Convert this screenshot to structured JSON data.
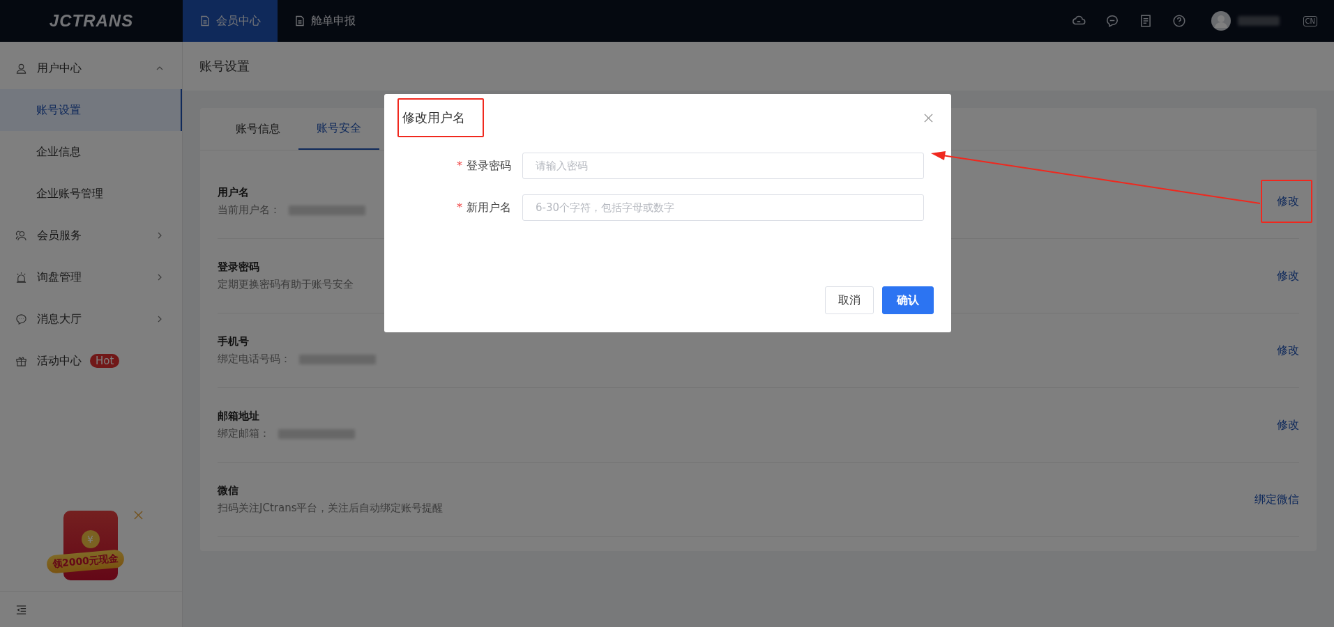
{
  "header": {
    "logo": "JCTRANS",
    "nav": [
      {
        "label": "会员中心",
        "selected": true
      },
      {
        "label": "舱单申报",
        "selected": false
      }
    ],
    "language": "CN"
  },
  "required_mark": "*",
  "sidebar": {
    "items": [
      {
        "label": "用户中心",
        "kind": "user",
        "expanded": true,
        "children": [
          {
            "label": "账号设置",
            "selected": true
          },
          {
            "label": "企业信息",
            "selected": false
          },
          {
            "label": "企业账号管理",
            "selected": false
          }
        ]
      },
      {
        "label": "会员服务",
        "kind": "members",
        "expanded": false
      },
      {
        "label": "询盘管理",
        "kind": "alarm",
        "expanded": false
      },
      {
        "label": "消息大厅",
        "kind": "chat",
        "expanded": false
      },
      {
        "label": "活动中心",
        "kind": "gift",
        "badge": "Hot"
      }
    ],
    "promo": {
      "coin": "¥",
      "label": "领2000元现金"
    }
  },
  "page_title": "账号设置",
  "tabs": [
    {
      "label": "账号信息",
      "selected": false
    },
    {
      "label": "账号安全",
      "selected": true
    }
  ],
  "rows": [
    {
      "title": "用户名",
      "description": "当前用户名：",
      "masked_value": true,
      "action": "修改"
    },
    {
      "title": "登录密码",
      "description": "定期更换密码有助于账号安全",
      "masked_value": false,
      "action": "修改"
    },
    {
      "title": "手机号",
      "description": "绑定电话号码：",
      "masked_value": true,
      "action": "修改"
    },
    {
      "title": "邮箱地址",
      "description": "绑定邮箱：",
      "masked_value": true,
      "action": "修改"
    },
    {
      "title": "微信",
      "description": "扫码关注JCtrans平台，关注后自动绑定账号提醒",
      "masked_value": false,
      "action": "绑定微信"
    }
  ],
  "dialog": {
    "title": "修改用户名",
    "fields": [
      {
        "label": "登录密码",
        "required": true,
        "placeholder": "请输入密码"
      },
      {
        "label": "新用户名",
        "required": true,
        "placeholder": "6-30个字符，包括字母或数字"
      }
    ],
    "buttons": [
      {
        "label": "取消",
        "kind": "default"
      },
      {
        "label": "确认",
        "kind": "primary"
      }
    ]
  }
}
